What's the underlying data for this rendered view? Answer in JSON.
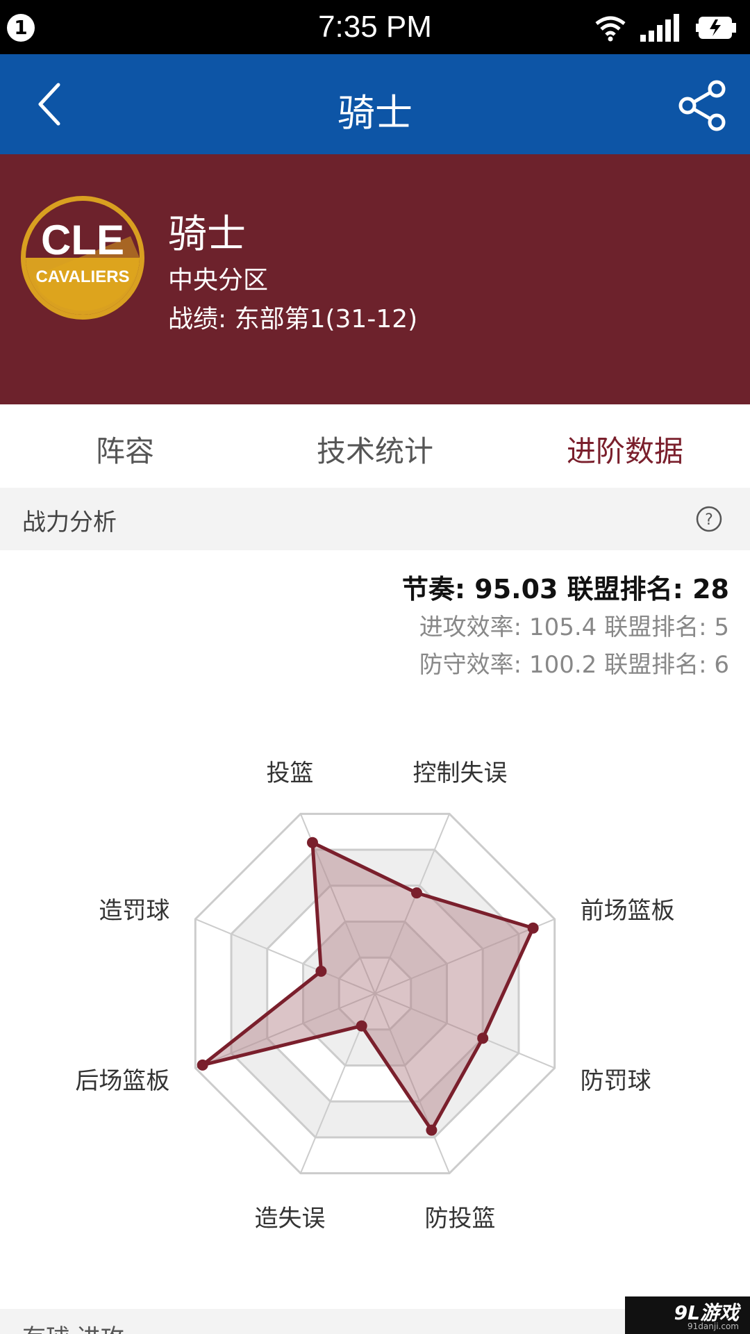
{
  "status_bar": {
    "notification_count": "1",
    "time": "7:35 PM"
  },
  "app_bar": {
    "title": "骑士",
    "back_icon": "chevron-left-icon",
    "share_icon": "share-icon"
  },
  "team": {
    "logo_icon": "cle-cavaliers-logo",
    "name": "骑士",
    "division": "中央分区",
    "record": "战绩: 东部第1(31-12)"
  },
  "tabs": [
    {
      "label": "阵容",
      "active": false
    },
    {
      "label": "技术统计",
      "active": false
    },
    {
      "label": "进阶数据",
      "active": true
    }
  ],
  "analysis": {
    "section_title": "战力分析",
    "help_icon": "question-circle-icon",
    "pace": "节奏: 95.03 联盟排名: 28",
    "offense": "进攻效率: 105.4 联盟排名: 5",
    "defense": "防守效率: 100.2 联盟排名: 6"
  },
  "chart_data": {
    "type": "radar",
    "axes": [
      "投篮",
      "控制失误",
      "前场篮板",
      "防罚球",
      "防投篮",
      "造失误",
      "后场篮板",
      "造罚球"
    ],
    "levels": 5,
    "max": 5,
    "series": [
      {
        "values": [
          4.2,
          2.8,
          4.4,
          3.0,
          3.8,
          0.9,
          4.8,
          1.5
        ]
      }
    ]
  },
  "bottom_section": {
    "title": "有球 进攻"
  },
  "watermark": {
    "main": "9L游戏",
    "sub": "91danji.com"
  },
  "colors": {
    "app_bar": "#0d55a6",
    "team_header": "#6d222c",
    "accent": "#7a1f2c",
    "radar_fill": "#b07c83"
  }
}
